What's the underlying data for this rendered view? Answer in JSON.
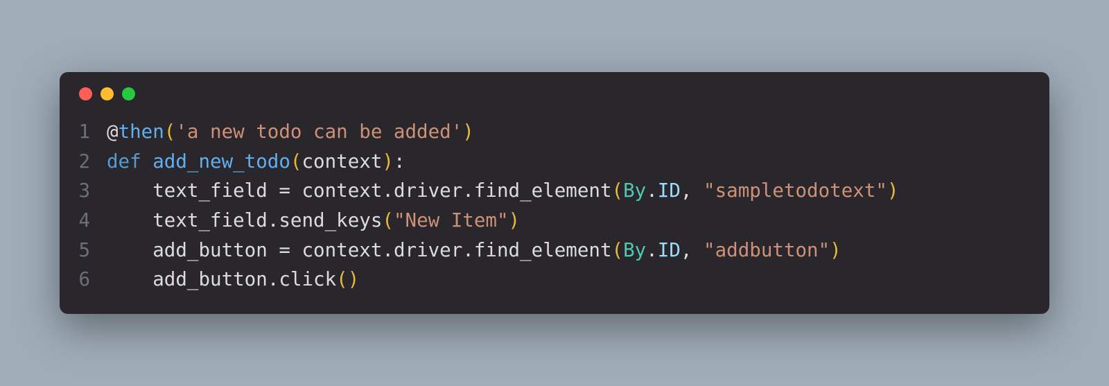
{
  "lineNumbers": [
    "1",
    "2",
    "3",
    "4",
    "5",
    "6"
  ],
  "tokens": {
    "l1_at": "@",
    "l1_then": "then",
    "l1_open": "(",
    "l1_string": "'a new todo can be added'",
    "l1_close": ")",
    "l2_def": "def",
    "l2_func": "add_new_todo",
    "l2_open": "(",
    "l2_param": "context",
    "l2_close": ")",
    "l2_colon": ":",
    "l3_indent": "    ",
    "l3_var": "text_field",
    "l3_eq": " = ",
    "l3_ctx": "context",
    "l3_d1": ".",
    "l3_drv": "driver",
    "l3_d2": ".",
    "l3_find": "find_element",
    "l3_open": "(",
    "l3_by": "By",
    "l3_d3": ".",
    "l3_id": "ID",
    "l3_comma": ", ",
    "l3_string": "\"sampletodotext\"",
    "l3_close": ")",
    "l4_indent": "    ",
    "l4_var": "text_field",
    "l4_d1": ".",
    "l4_send": "send_keys",
    "l4_open": "(",
    "l4_string": "\"New Item\"",
    "l4_close": ")",
    "l5_indent": "    ",
    "l5_var": "add_button",
    "l5_eq": " = ",
    "l5_ctx": "context",
    "l5_d1": ".",
    "l5_drv": "driver",
    "l5_d2": ".",
    "l5_find": "find_element",
    "l5_open": "(",
    "l5_by": "By",
    "l5_d3": ".",
    "l5_id": "ID",
    "l5_comma": ", ",
    "l5_string": "\"addbutton\"",
    "l5_close": ")",
    "l6_indent": "    ",
    "l6_var": "add_button",
    "l6_d1": ".",
    "l6_click": "click",
    "l6_open": "(",
    "l6_close": ")"
  }
}
